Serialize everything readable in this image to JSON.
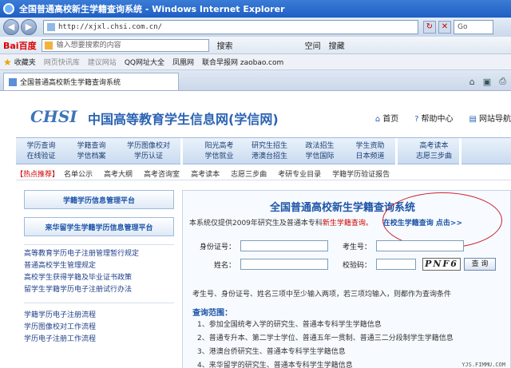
{
  "window": {
    "title": "全国普通高校新生学籍查询系统 - Windows Internet Explorer"
  },
  "address": {
    "url": "http://xjxl.chsi.com.cn/",
    "search_box": "Go"
  },
  "baidu_toolbar": {
    "brand": "Bai百度",
    "search_placeholder": "输入想要搜索的内容",
    "search_label": "搜索",
    "items": [
      "空间",
      "搜藏"
    ]
  },
  "favorites": {
    "label": "收藏夹",
    "items": [
      "网页快讯库",
      "建议网站",
      "QQ网址大全",
      "凤凰网",
      "联合早报网 zaobao.com"
    ]
  },
  "tab": {
    "title": "全国普通高校新生学籍查询系统"
  },
  "site": {
    "logo": "CHSI",
    "title": "中国高等教育学生信息网(学信网)",
    "top_links": [
      "首页",
      "帮助中心",
      "网站导航"
    ]
  },
  "nav": {
    "groups": [
      [
        [
          "学历查询",
          "在线验证"
        ],
        [
          "学籍查询",
          "学信档案"
        ],
        [
          "学历图像校对",
          "学历认证"
        ]
      ],
      [
        [
          "阳光高考",
          "学信就业"
        ],
        [
          "研究生招生",
          "港澳台招生"
        ],
        [
          "政法招生",
          "学信国际"
        ],
        [
          "学生资助",
          "日本频道"
        ]
      ],
      [
        [
          "高考读本",
          "志愿三步曲"
        ]
      ]
    ]
  },
  "hot": {
    "label": "【热点推荐】",
    "items": [
      "名单公示",
      "高考大纲",
      "高考咨询室",
      "高考读本",
      "志愿三步曲",
      "考研专业目录",
      "学籍学历验证报告"
    ]
  },
  "left": {
    "box1": "学籍学历信息管理平台",
    "box2": "来华留学生学籍学历信息管理平台",
    "list1": [
      "高等教育学历电子注册管理暂行规定",
      "普通高校学生管理规定",
      "高校学生获得学籍及毕业证书政策",
      "留学生学籍学历电子注册试行办法"
    ],
    "list2": [
      "学籍学历电子注册流程",
      "学历图像校对工作流程",
      "学历电子注册工作流程"
    ]
  },
  "main": {
    "title": "全国普通高校新生学籍查询系统",
    "desc_pre": "本系统仅提供2009年研究生及普通本专科",
    "desc_red": "新生学籍查询。",
    "desc_link": "在校生学籍查询 点击>>",
    "form": {
      "id_label": "身份证号：",
      "exam_label": "考生号：",
      "name_label": "姓名：",
      "code_label": "校验码：",
      "captcha": "PNF6",
      "query_button": "查 询"
    },
    "hint": "考生号、身份证号、姓名三项中至少输入两项，若三项均输入，则都作为查询条件",
    "scope_head": "查询范围：",
    "scope": [
      "1、参加全国统考入学的研究生、普通本专科学生学籍信息",
      "2、普通专升本、第二学士学位、普通五年一贯制、普通三二分段制学生学籍信息",
      "3、港澳台侨研究生、普通本专科学生学籍信息",
      "4、来华留学的研究生、普通本专科学生学籍信息"
    ]
  },
  "watermark": "YJS.FIMMU.COM"
}
